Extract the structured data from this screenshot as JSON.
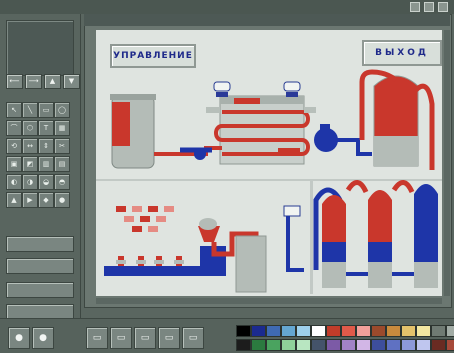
{
  "window": {
    "title_text": "",
    "buttons": [
      "minimize",
      "maximize",
      "close"
    ]
  },
  "sidebar": {
    "project_lines": [
      "",
      "",
      ""
    ],
    "nav_buttons": [
      "⟵",
      "⟶",
      "▲",
      "▼"
    ],
    "tools": [
      "↖",
      "╲",
      "▭",
      "◯",
      "⌒",
      "⬡",
      "T",
      "▦",
      "⟲",
      "↔",
      "⇕",
      "✂",
      "▣",
      "◩",
      "▥",
      "▤",
      "◐",
      "◑",
      "◒",
      "◓",
      "▲",
      "▶",
      "◆",
      "●"
    ],
    "buttons": [
      "",
      "",
      "",
      ""
    ]
  },
  "canvas": {
    "coords_text": "",
    "btn_upr_label": "УПРАВЛЕНИЕ",
    "btn_exit_label": "ВЫХОД",
    "caption": ""
  },
  "bottom": {
    "buttons": [
      "●",
      "●",
      "▭",
      "▭",
      "▭",
      "▭",
      "▭"
    ],
    "palette": [
      "#000000",
      "#1b2a8f",
      "#3f6ab3",
      "#65a7d2",
      "#9ed0ec",
      "#ffffff",
      "#c13c2a",
      "#e05a4a",
      "#f2a09a",
      "#9b4a2c",
      "#c88a3d",
      "#e3c26b",
      "#f3e7a1",
      "#6f7a73",
      "#a2aca6",
      "#d9dedb",
      "#1c1c1c",
      "#2b7a3f",
      "#4aa35f",
      "#8fd19a",
      "#b8e6c1",
      "#44536a",
      "#7c5aa6",
      "#a182c6",
      "#d2b6e6",
      "#3d4e9c",
      "#5f71c2",
      "#8d9ad9",
      "#bfc6ef",
      "#6a2b22",
      "#a74a3a",
      "#e7d3ce"
    ]
  }
}
